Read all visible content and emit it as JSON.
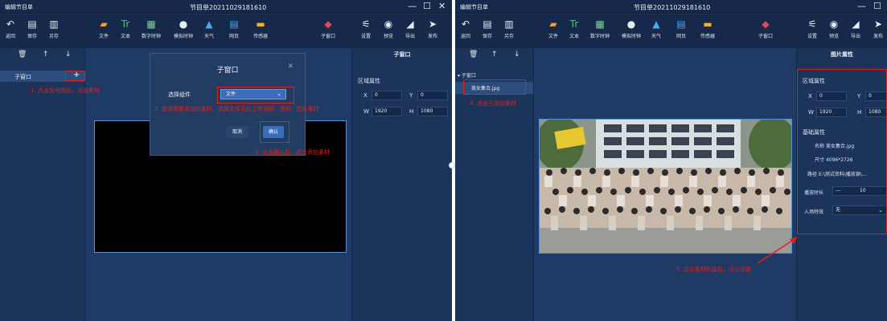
{
  "left_window": {
    "app_name": "编辑节目单",
    "doc_title": "节目单20211029181610",
    "window_controls": [
      "—",
      "☐",
      "✕"
    ],
    "toolbar_left": [
      {
        "label": "返回",
        "glyph": "↶",
        "icon": "back-icon"
      },
      {
        "label": "保存",
        "glyph": "▤",
        "icon": "save-icon"
      },
      {
        "label": "另存",
        "glyph": "▥",
        "icon": "save-as-icon"
      }
    ],
    "toolbar_center": [
      {
        "label": "文件",
        "glyph": "▰",
        "icon": "folder-icon",
        "color": "#f0a030"
      },
      {
        "label": "文本",
        "glyph": "Tr",
        "icon": "text-icon",
        "color": "#40c870"
      },
      {
        "label": "数字时钟",
        "glyph": "▦",
        "icon": "digital-clock-icon",
        "color": "#7fd0a0"
      },
      {
        "label": "模拟时钟",
        "glyph": "●",
        "icon": "analog-clock-icon",
        "color": "#e6edf7"
      },
      {
        "label": "天气",
        "glyph": "▲",
        "icon": "weather-icon",
        "color": "#4aa8f0"
      },
      {
        "label": "网页",
        "glyph": "▤",
        "icon": "webpage-icon",
        "color": "#4aa8f0"
      },
      {
        "label": "传感器",
        "glyph": "▬",
        "icon": "sensor-icon",
        "color": "#f0b030"
      },
      {
        "label": "子窗口",
        "glyph": "◆",
        "icon": "subwindow-icon",
        "color": "#e04a5a"
      }
    ],
    "toolbar_right": [
      {
        "label": "设置",
        "glyph": "⚟",
        "icon": "settings-icon"
      },
      {
        "label": "预览",
        "glyph": "◉",
        "icon": "preview-icon"
      },
      {
        "label": "导出",
        "glyph": "◢",
        "icon": "export-icon"
      },
      {
        "label": "发布",
        "glyph": "➤",
        "icon": "publish-icon"
      }
    ],
    "layer_tools": [
      "🗑",
      "↑",
      "↓"
    ],
    "tree_item": "子窗口",
    "tree_add": "+",
    "right_panel_title": "子窗口",
    "region_title": "区域属性",
    "x_label": "X",
    "x_value": "0",
    "y_label": "Y",
    "y_value": "0",
    "w_label": "W",
    "w_value": "1920",
    "h_label": "H",
    "h_value": "1080",
    "dialog": {
      "title": "子窗口",
      "close": "✕",
      "component_label": "选择组件",
      "component_value": "文件",
      "cancel": "取消",
      "confirm": "确认"
    },
    "notes": {
      "step1": "1. 点击加号图标，添加素材",
      "step2": "2. 选择需要添加的素材，选择文件可以上传视频、音频、图片素材",
      "step3": "3. 点击确认后，成功添加素材"
    }
  },
  "right_window": {
    "app_name": "编辑节目单",
    "doc_title": "节目单20211029181610",
    "window_controls": [
      "—",
      "☐"
    ],
    "toolbar_left": [
      {
        "label": "返回",
        "glyph": "↶",
        "icon": "back-icon"
      },
      {
        "label": "保存",
        "glyph": "▤",
        "icon": "save-icon"
      },
      {
        "label": "另存",
        "glyph": "▥",
        "icon": "save-as-icon"
      }
    ],
    "toolbar_center": [
      {
        "label": "文件",
        "glyph": "▰",
        "icon": "folder-icon",
        "color": "#f0a030"
      },
      {
        "label": "文本",
        "glyph": "Tr",
        "icon": "text-icon",
        "color": "#40c870"
      },
      {
        "label": "数字时钟",
        "glyph": "▦",
        "icon": "digital-clock-icon",
        "color": "#7fd0a0"
      },
      {
        "label": "模拟时钟",
        "glyph": "●",
        "icon": "analog-clock-icon",
        "color": "#e6edf7"
      },
      {
        "label": "天气",
        "glyph": "▲",
        "icon": "weather-icon",
        "color": "#4aa8f0"
      },
      {
        "label": "网页",
        "glyph": "▤",
        "icon": "webpage-icon",
        "color": "#4aa8f0"
      },
      {
        "label": "传感器",
        "glyph": "▬",
        "icon": "sensor-icon",
        "color": "#f0b030"
      },
      {
        "label": "子窗口",
        "glyph": "◆",
        "icon": "subwindow-icon",
        "color": "#e04a5a"
      }
    ],
    "toolbar_right": [
      {
        "label": "设置",
        "glyph": "⚟",
        "icon": "settings-icon"
      },
      {
        "label": "预览",
        "glyph": "◉",
        "icon": "preview-icon"
      },
      {
        "label": "导出",
        "glyph": "◢",
        "icon": "export-icon"
      },
      {
        "label": "发布",
        "glyph": "➤",
        "icon": "publish-icon"
      }
    ],
    "layer_tools": [
      "🗑",
      "↑",
      "↓"
    ],
    "tree_parent": "▾ 子窗口",
    "tree_child": "美女集合.jpg",
    "right_panel_title": "图片属性",
    "region_title": "区域属性",
    "x_label": "X",
    "x_value": "0",
    "y_label": "Y",
    "y_value": "0",
    "w_label": "W",
    "w_value": "1920",
    "h_label": "H",
    "h_value": "1080",
    "basic_title": "基础属性",
    "name_label": "名称",
    "name_value": "美女集合.jpg",
    "size_label": "尺寸",
    "size_value": "4096*2726",
    "path_label": "路径",
    "path_value": "E:\\测试资料\\播放源\\...",
    "duration_label": "播放时长",
    "duration_minus": "—",
    "duration_value": "10",
    "entry_label": "入场特效",
    "entry_value": "无",
    "notes": {
      "step4": "4. 点击已添加素材",
      "step5": "5. 显示素材的属性，可以设置"
    }
  },
  "colors": {
    "panel": "#1f3a64",
    "titlebar": "#17294a",
    "accent": "#3a6eb8",
    "annotation": "#e02020"
  }
}
